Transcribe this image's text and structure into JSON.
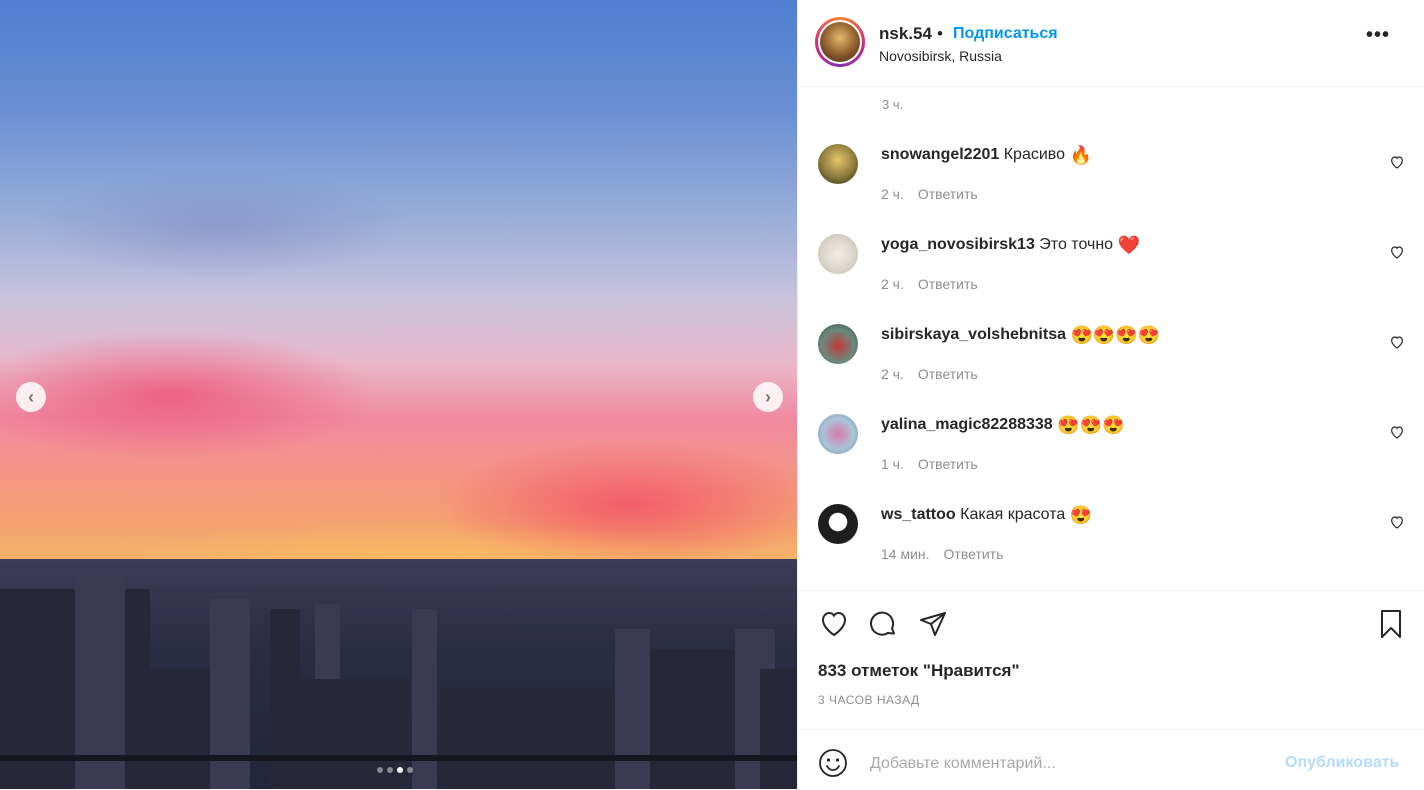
{
  "post": {
    "carousel": {
      "slide_count": 4,
      "active_slide": 3
    }
  },
  "header": {
    "username": "nsk.54",
    "separator": "•",
    "follow_label": "Подписаться",
    "location": "Novosibirsk, Russia",
    "more_label": "•••"
  },
  "comments": {
    "top_time": "3 ч.",
    "reply_label": "Ответить",
    "items": [
      {
        "username": "snowangel2201",
        "text": "Красиво",
        "emoji": "🔥",
        "time": "2 ч.",
        "avatar_color": "#8a7a3c"
      },
      {
        "username": "yoga_novosibirsk13",
        "text": "Это точно",
        "emoji": "❤️",
        "time": "2 ч.",
        "avatar_color": "#d8d2c9"
      },
      {
        "username": "sibirskaya_volshebnitsa",
        "text": "",
        "emoji": "😍😍😍😍",
        "time": "2 ч.",
        "avatar_color": "#6c8a7e"
      },
      {
        "username": "yalina_magic82288338",
        "text": "",
        "emoji": "😍😍😍",
        "time": "1 ч.",
        "avatar_color": "#a9c4d8"
      },
      {
        "username": "ws_tattoo",
        "text": "Какая красота",
        "emoji": "😍",
        "time": "14 мин.",
        "avatar_color": "#1e1e1e"
      }
    ]
  },
  "actions": {
    "likes_text": "833 отметок \"Нравится\"",
    "posted_text": "3 ЧАСОВ НАЗАД"
  },
  "add_comment": {
    "placeholder": "Добавьте комментарий...",
    "publish_label": "Опубликовать"
  },
  "colors": {
    "accent": "#0095f6",
    "publish_disabled": "#b3dbff",
    "muted": "#8e8e8e"
  }
}
